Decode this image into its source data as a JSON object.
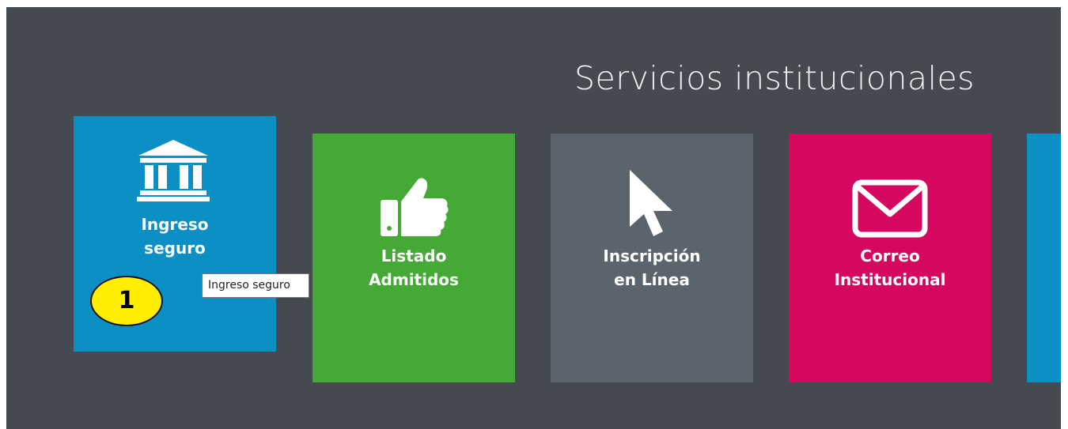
{
  "section": {
    "title": "Servicios institucionales"
  },
  "tiles": [
    {
      "label_line1": "Ingreso",
      "label_line2": "seguro",
      "color": "#0b8fc4",
      "icon": "bank-icon"
    },
    {
      "label_line1": "Listado",
      "label_line2": "Admitidos",
      "color": "#45a935",
      "icon": "thumbs-up-icon"
    },
    {
      "label_line1": "Inscripción",
      "label_line2": "en Línea",
      "color": "#5b646d",
      "icon": "cursor-arrow-icon"
    },
    {
      "label_line1": "Correo",
      "label_line2": "Institucional",
      "color": "#d6075e",
      "icon": "envelope-icon"
    },
    {
      "color": "#0b8fc4"
    }
  ],
  "tooltip": {
    "text": "Ingreso seguro"
  },
  "annotation": {
    "number": "1",
    "color": "#ffee00"
  },
  "colors": {
    "panel_bg": "#454a50",
    "title_text": "#f2f2f2"
  }
}
